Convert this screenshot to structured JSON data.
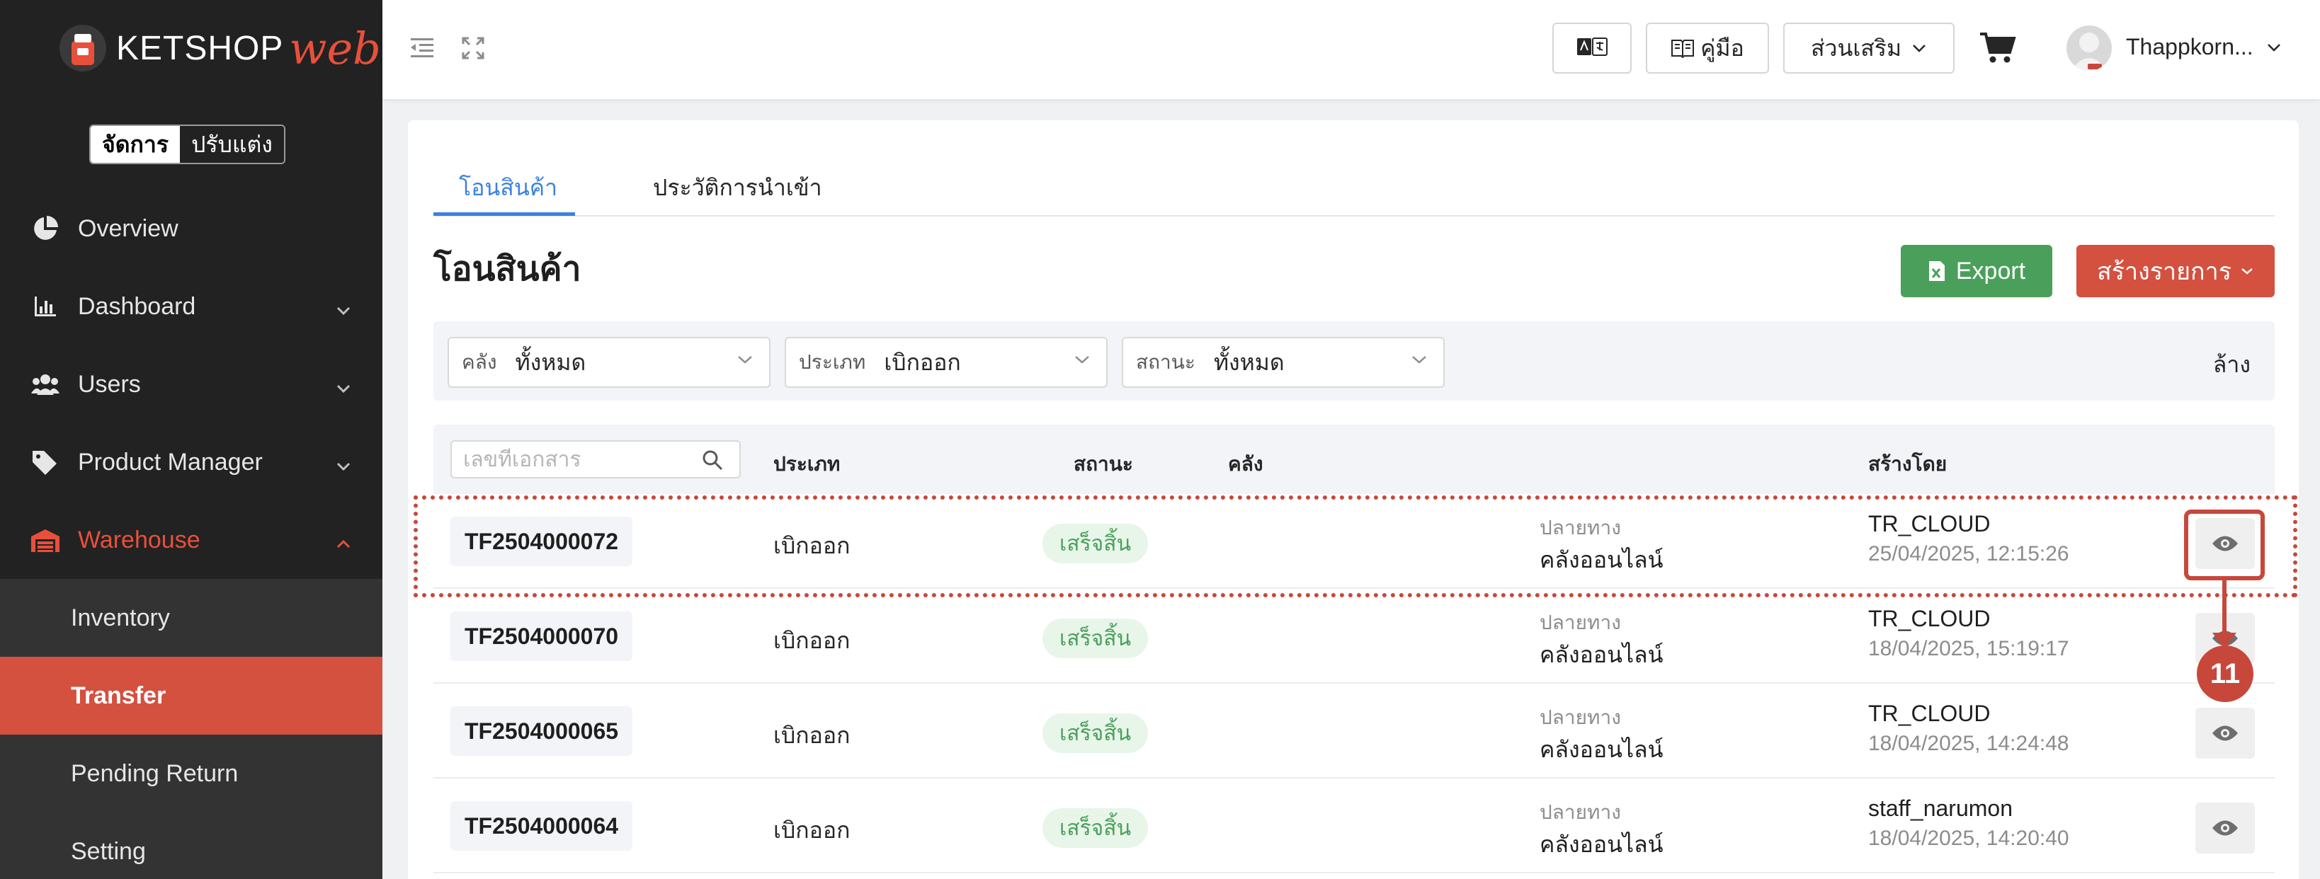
{
  "brand": {
    "name": "KETSHOP",
    "suffix": "web"
  },
  "mode_toggle": {
    "manage": "จัดการ",
    "customize": "ปรับแต่ง"
  },
  "sidebar": {
    "items": [
      {
        "label": "Overview",
        "icon": "pie-chart-icon"
      },
      {
        "label": "Dashboard",
        "icon": "bar-chart-icon"
      },
      {
        "label": "Users",
        "icon": "users-icon"
      },
      {
        "label": "Product Manager",
        "icon": "tags-icon"
      },
      {
        "label": "Warehouse",
        "icon": "warehouse-icon"
      }
    ],
    "subitems": [
      {
        "label": "Inventory"
      },
      {
        "label": "Transfer"
      },
      {
        "label": "Pending Return"
      },
      {
        "label": "Setting"
      }
    ]
  },
  "topbar": {
    "manual_label": "คู่มือ",
    "addons_label": "ส่วนเสริม",
    "username": "Thappkorn..."
  },
  "tabs": [
    {
      "label": "โอนสินค้า"
    },
    {
      "label": "ประวัติการนำเข้า"
    }
  ],
  "page": {
    "title": "โอนสินค้า",
    "export_label": "Export",
    "create_label": "สร้างรายการ"
  },
  "filters": {
    "warehouse": {
      "label": "คลัง",
      "value": "ทั้งหมด"
    },
    "type": {
      "label": "ประเภท",
      "value": "เบิกออก"
    },
    "status": {
      "label": "สถานะ",
      "value": "ทั้งหมด"
    },
    "clear_label": "ล้าง"
  },
  "table": {
    "search_placeholder": "เลขที่เอกสาร",
    "headers": {
      "type": "ประเภท",
      "status": "สถานะ",
      "warehouse": "คลัง",
      "created_by": "สร้างโดย"
    },
    "rows": [
      {
        "doc": "TF2504000072",
        "type": "เบิกออก",
        "status": "เสร็จสิ้น",
        "dest_label": "ปลายทาง",
        "dest": "คลังออนไลน์",
        "creator": "TR_CLOUD",
        "created_at": "25/04/2025, 12:15:26"
      },
      {
        "doc": "TF2504000070",
        "type": "เบิกออก",
        "status": "เสร็จสิ้น",
        "dest_label": "ปลายทาง",
        "dest": "คลังออนไลน์",
        "creator": "TR_CLOUD",
        "created_at": "18/04/2025, 15:19:17"
      },
      {
        "doc": "TF2504000065",
        "type": "เบิกออก",
        "status": "เสร็จสิ้น",
        "dest_label": "ปลายทาง",
        "dest": "คลังออนไลน์",
        "creator": "TR_CLOUD",
        "created_at": "18/04/2025, 14:24:48"
      },
      {
        "doc": "TF2504000064",
        "type": "เบิกออก",
        "status": "เสร็จสิ้น",
        "dest_label": "ปลายทาง",
        "dest": "คลังออนไลน์",
        "creator": "staff_narumon",
        "created_at": "18/04/2025, 14:20:40"
      }
    ]
  },
  "annotation": {
    "step": "11"
  },
  "colors": {
    "accent": "#d4503f",
    "tab_active": "#3b82e0",
    "export": "#4aa05b",
    "sidebar": "#222222",
    "annotation": "#c8473b"
  }
}
